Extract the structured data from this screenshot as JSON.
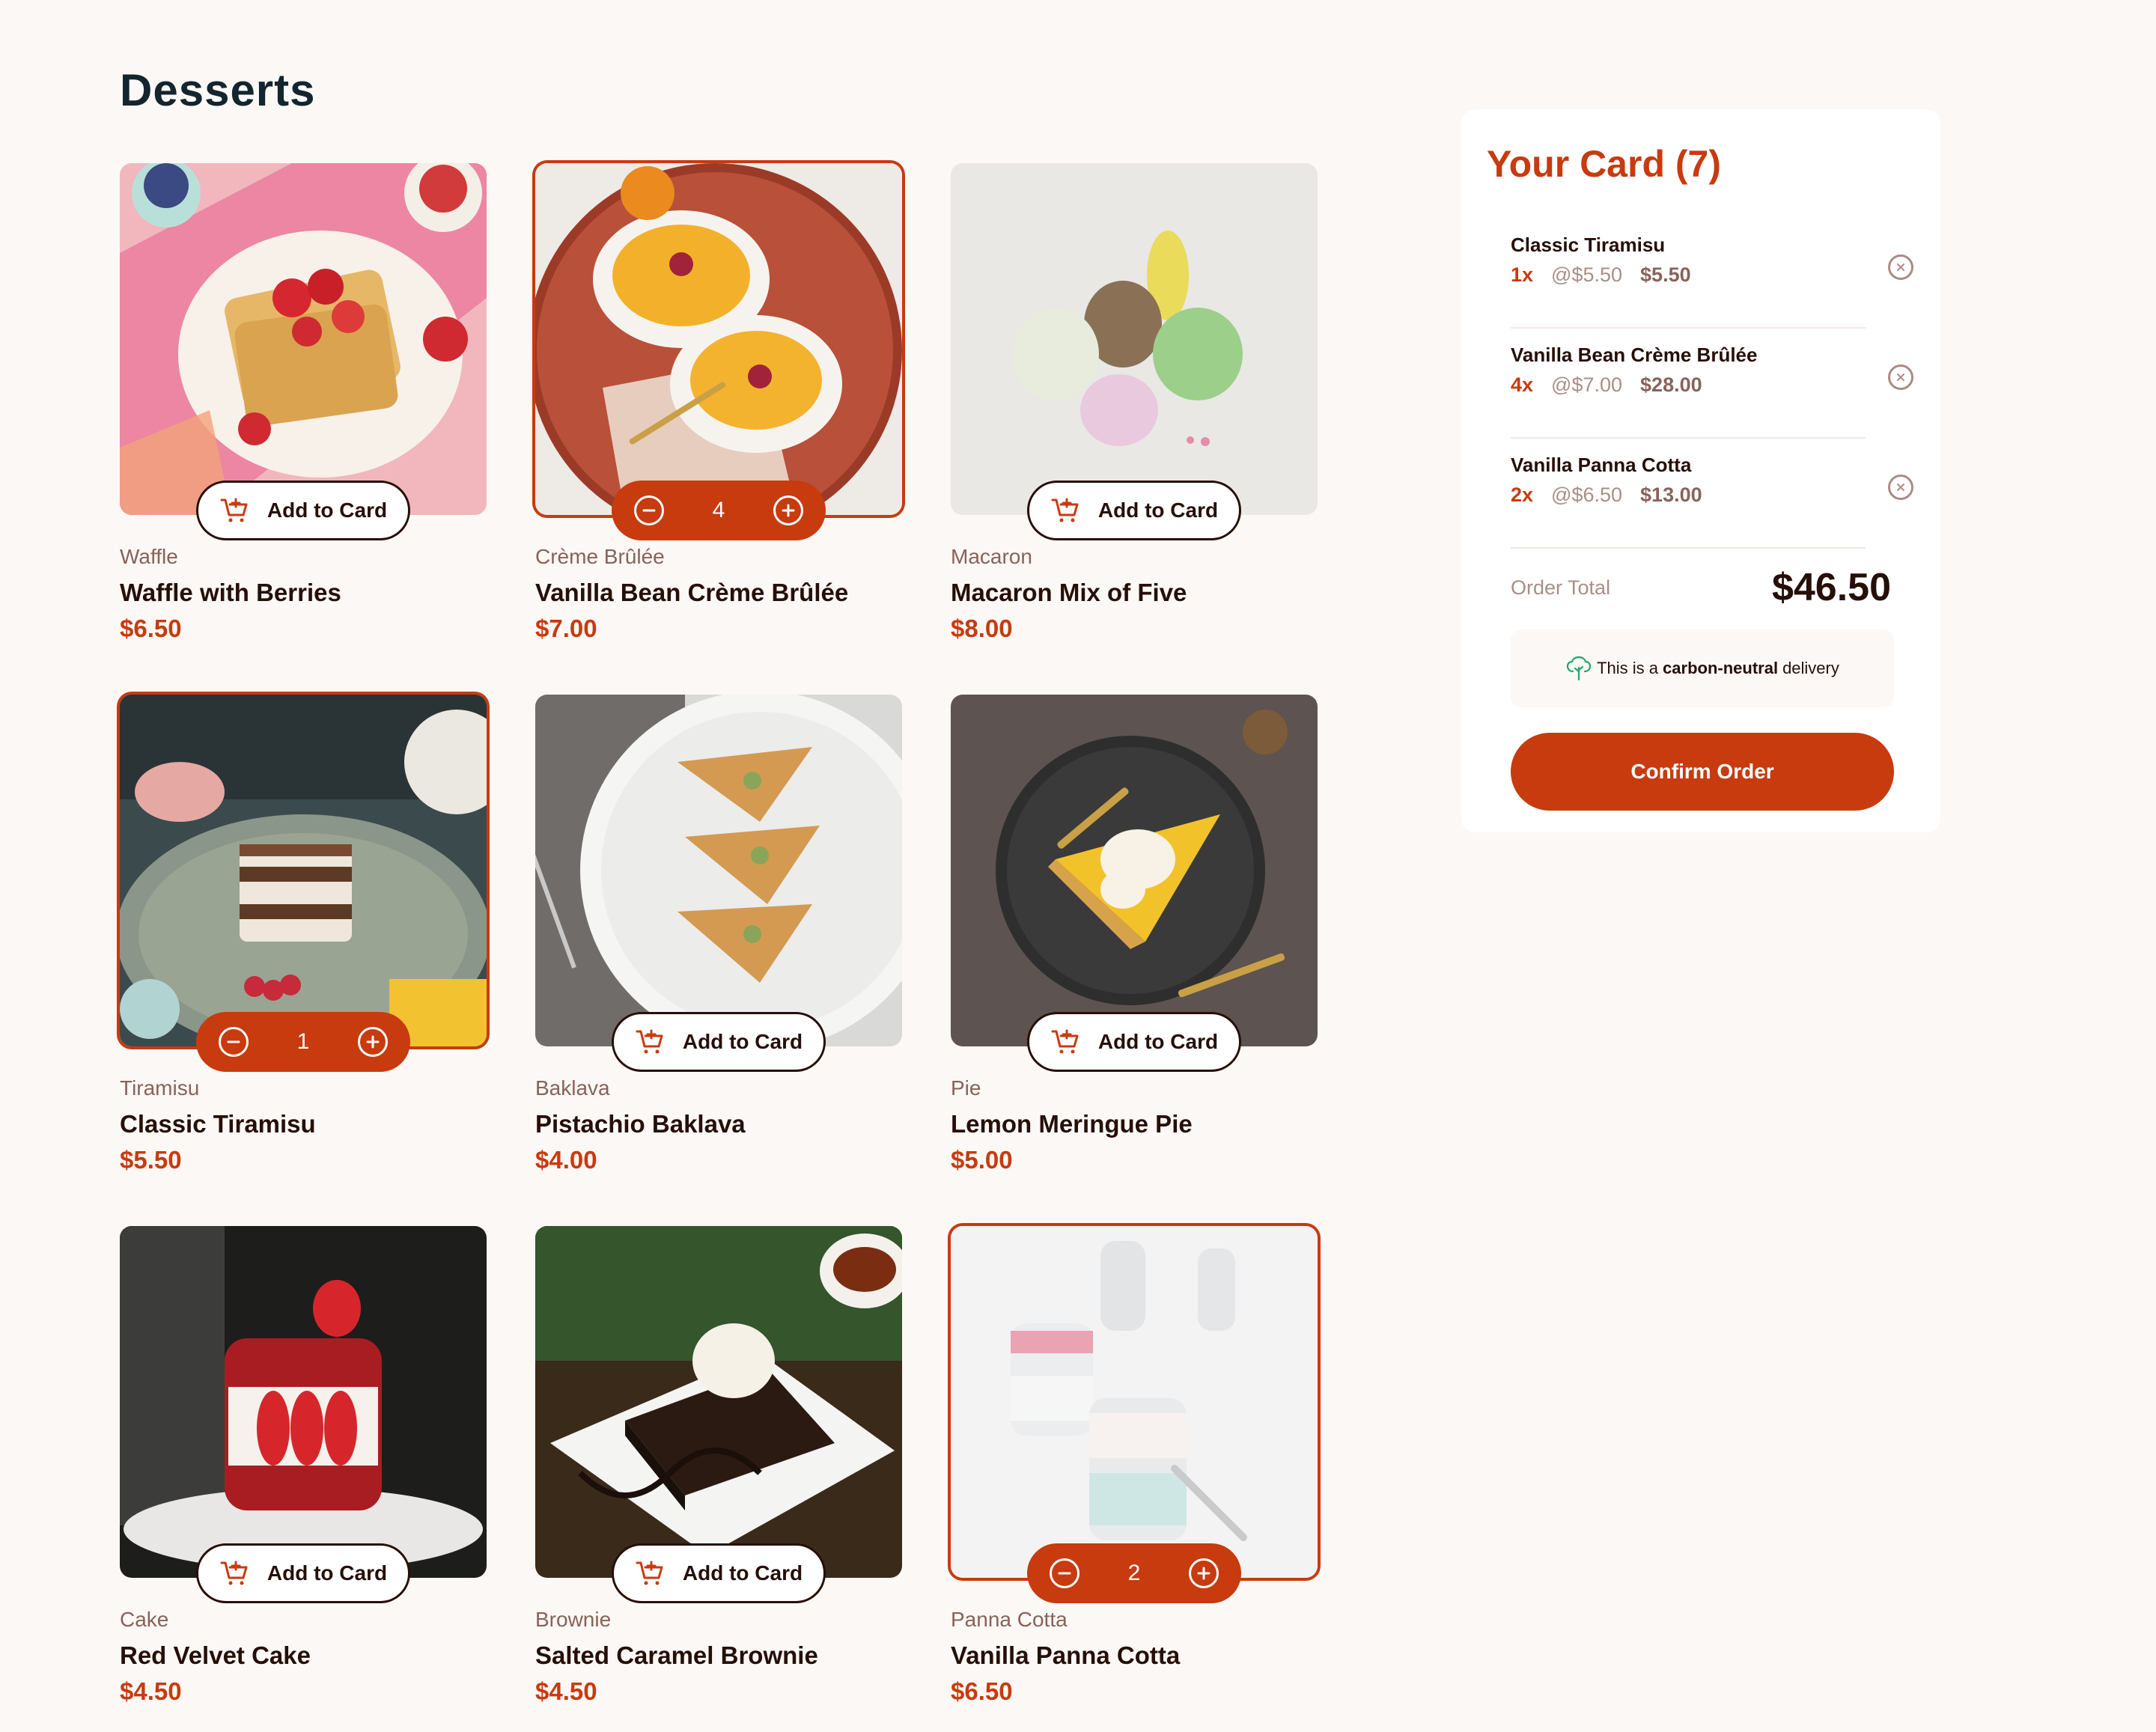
{
  "page_title": "Desserts",
  "add_label": "Add to Card",
  "colors": {
    "accent": "#c73b0f",
    "rose900": "#260f08",
    "background": "#fcf8f5"
  },
  "products": [
    {
      "category": "Waffle",
      "name": "Waffle with Berries",
      "price": "$6.50",
      "in_cart": false,
      "image": "waffle-image"
    },
    {
      "category": "Crème Brûlée",
      "name": "Vanilla Bean Crème Brûlée",
      "price": "$7.00",
      "in_cart": true,
      "quantity": "4",
      "image": "creme-brulee-image"
    },
    {
      "category": "Macaron",
      "name": "Macaron Mix of Five",
      "price": "$8.00",
      "in_cart": false,
      "image": "macaron-image"
    },
    {
      "category": "Tiramisu",
      "name": "Classic Tiramisu",
      "price": "$5.50",
      "in_cart": true,
      "quantity": "1",
      "image": "tiramisu-image"
    },
    {
      "category": "Baklava",
      "name": "Pistachio Baklava",
      "price": "$4.00",
      "in_cart": false,
      "image": "baklava-image"
    },
    {
      "category": "Pie",
      "name": "Lemon Meringue Pie",
      "price": "$5.00",
      "in_cart": false,
      "image": "pie-image"
    },
    {
      "category": "Cake",
      "name": "Red Velvet Cake",
      "price": "$4.50",
      "in_cart": false,
      "image": "cake-image"
    },
    {
      "category": "Brownie",
      "name": "Salted Caramel Brownie",
      "price": "$4.50",
      "in_cart": false,
      "image": "brownie-image"
    },
    {
      "category": "Panna Cotta",
      "name": "Vanilla Panna Cotta",
      "price": "$6.50",
      "in_cart": true,
      "quantity": "2",
      "image": "panna-cotta-image"
    }
  ],
  "cart": {
    "title": "Your Card (7)",
    "items": [
      {
        "name": "Classic Tiramisu",
        "qty": "1x",
        "unit": "@$5.50",
        "total": "$5.50"
      },
      {
        "name": "Vanilla Bean Crème Brûlée",
        "qty": "4x",
        "unit": "@$7.00",
        "total": "$28.00"
      },
      {
        "name": "Vanilla Panna Cotta",
        "qty": "2x",
        "unit": "@$6.50",
        "total": "$13.00"
      }
    ],
    "order_total_label": "Order Total",
    "order_total_value": "$46.50",
    "carbon_prefix": "This is a",
    "carbon_bold": "carbon-neutral",
    "carbon_suffix": "delivery",
    "confirm_label": "Confirm Order"
  }
}
